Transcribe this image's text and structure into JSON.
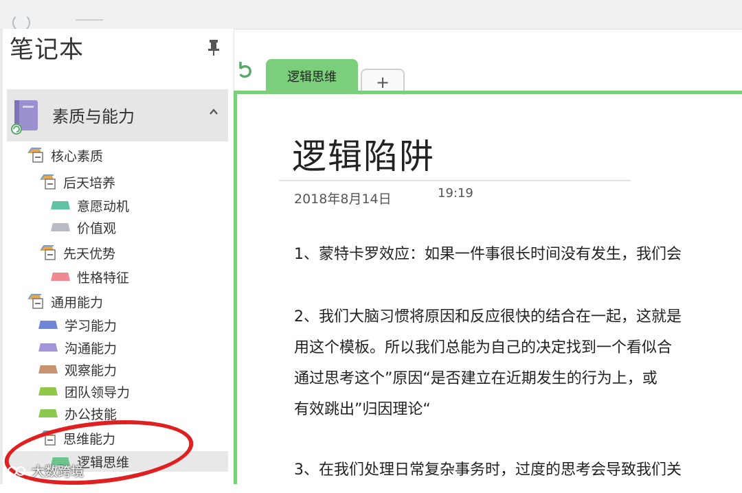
{
  "sidebar": {
    "title": "笔记本",
    "notebook": {
      "name": "素质与能力",
      "color": "#9b8fcf"
    },
    "items": [
      {
        "label": "核心素质",
        "kind": "group"
      },
      {
        "label": "后天培养",
        "kind": "group"
      },
      {
        "label": "意愿动机",
        "kind": "section",
        "color": "#5ec2a4"
      },
      {
        "label": "价值观",
        "kind": "section",
        "color": "#b8bcc2"
      },
      {
        "label": "先天优势",
        "kind": "group"
      },
      {
        "label": "性格特征",
        "kind": "section",
        "color": "#ee8a91"
      },
      {
        "label": "通用能力",
        "kind": "group"
      },
      {
        "label": "学习能力",
        "kind": "section",
        "color": "#6f86d8"
      },
      {
        "label": "沟通能力",
        "kind": "section",
        "color": "#a395d8"
      },
      {
        "label": "观察能力",
        "kind": "section",
        "color": "#c89370"
      },
      {
        "label": "团队领导力",
        "kind": "section",
        "color": "#92c84a"
      },
      {
        "label": "办公技能",
        "kind": "section",
        "color": "#8cc84f"
      },
      {
        "label": "思维能力",
        "kind": "group"
      },
      {
        "label": "逻辑思维",
        "kind": "section",
        "color": "#6cc48c",
        "selected": true
      }
    ]
  },
  "tabs": {
    "active_label": "逻辑思维",
    "add_label": "+",
    "accent": "#7bcf7b"
  },
  "page": {
    "title": "逻辑陷阱",
    "date": "2018年8月14日",
    "time": "19:19",
    "paragraphs": [
      "1、蒙特卡罗效应：如果一件事很长时间没有发生，我们会",
      "2、我们大脑习惯将原因和反应很快的结合在一起，这就是",
      "用这个模板。所以我们总能为自己的决定找到一个看似合",
      "通过思考这个”原因“是否建立在近期发生的行为上，或",
      "有效跳出”归因理论“",
      "3、在我们处理日常复杂事务时，过度的思考会导致我们关"
    ]
  },
  "annotation": {
    "color": "#e02020"
  },
  "watermark": {
    "text": "大数跨境"
  }
}
